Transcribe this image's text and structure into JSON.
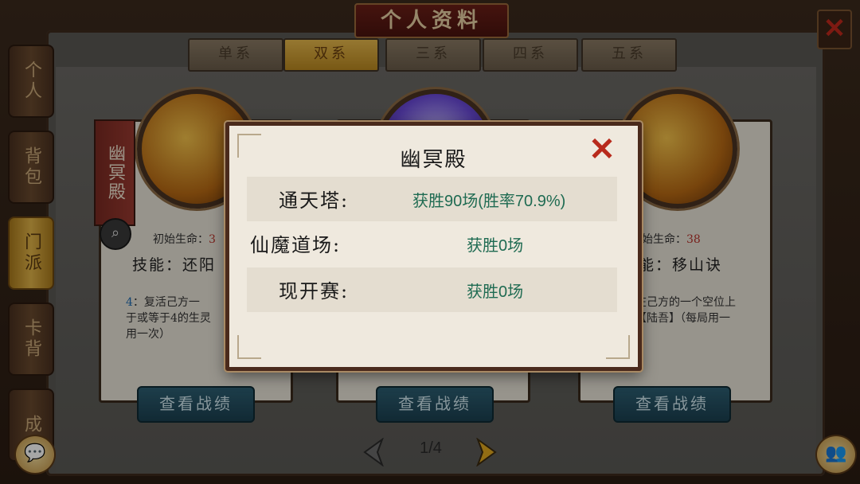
{
  "header": {
    "title": "个人资料"
  },
  "side_tabs": [
    {
      "label": "个人"
    },
    {
      "label": "背包"
    },
    {
      "label": "门派",
      "active": true
    },
    {
      "label": "卡背"
    },
    {
      "label": "成"
    }
  ],
  "top_tabs": [
    {
      "label": "单系"
    },
    {
      "label": "双系",
      "active": true
    },
    {
      "label": "三系"
    },
    {
      "label": "四系"
    },
    {
      "label": "五系"
    }
  ],
  "cards": [
    {
      "banner": "幽冥殿",
      "life_label": "初始生命：",
      "life_value": "3",
      "skill": "技能：还阳",
      "desc_badge": "4",
      "desc": "：复活己方一\n于或等于4的生灵\n用一次）",
      "button": "查看战绩"
    },
    {
      "button": "查看战绩"
    },
    {
      "life_label": "初始生命：",
      "life_value": "38",
      "skill": "能：移山诀",
      "desc": "在己方的一个空位上\n【陆吾】（每局用一\n",
      "button": "查看战绩"
    }
  ],
  "pager": {
    "text": "1/4"
  },
  "popup": {
    "title": "幽冥殿",
    "stats": [
      {
        "label": "通天塔:",
        "value": "获胜90场(胜率70.9%)"
      },
      {
        "label": "仙魔道场:",
        "value": "获胜0场"
      },
      {
        "label": "现开赛:",
        "value": "获胜0场"
      }
    ]
  },
  "icons": {
    "close": "close-icon",
    "search": "search-icon",
    "chat": "chat-icon",
    "friends": "friends-icon",
    "prev": "arrow-left-icon",
    "next": "arrow-right-icon"
  }
}
